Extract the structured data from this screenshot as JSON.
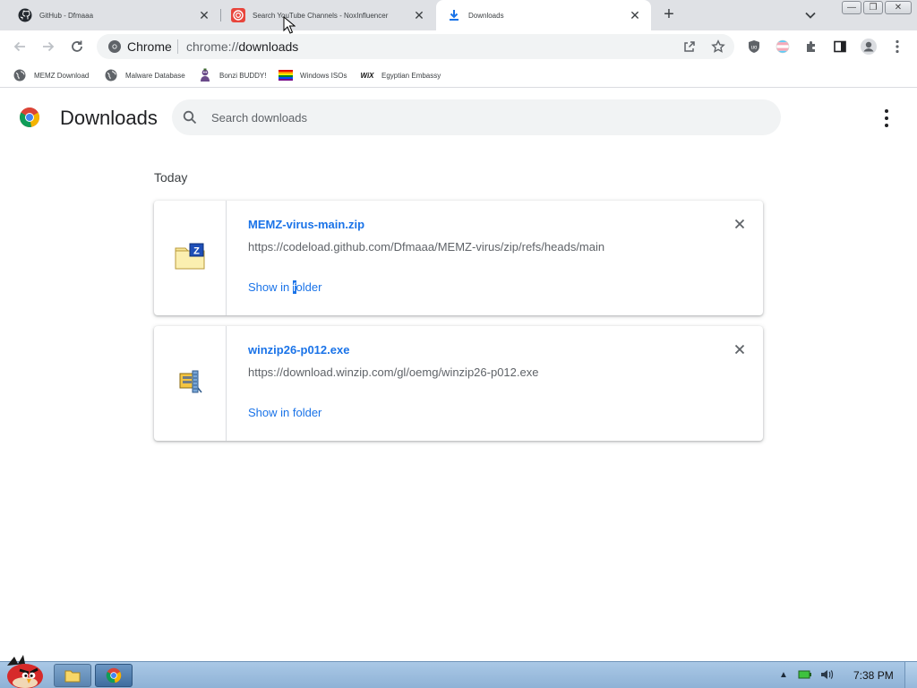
{
  "tabs": [
    {
      "title": "GitHub - Dfmaaa",
      "icon": "github-icon",
      "active": false
    },
    {
      "title": "Search YouTube Channels - NoxInfluencer",
      "icon": "noxinfluencer-icon",
      "active": false
    },
    {
      "title": "Downloads",
      "icon": "download-icon",
      "active": true
    }
  ],
  "omnibox": {
    "site_label": "Chrome",
    "url_scheme": "chrome://",
    "url_rest": "downloads"
  },
  "bookmarks": [
    {
      "label": "MEMZ Download",
      "icon": "globe-icon"
    },
    {
      "label": "Malware Database",
      "icon": "globe-icon"
    },
    {
      "label": "Bonzi BUDDY!",
      "icon": "bonzi-icon"
    },
    {
      "label": "Windows ISOs",
      "icon": "rainbow-flag-icon"
    },
    {
      "label": "Egyptian Embassy",
      "icon": "wix-icon"
    }
  ],
  "page": {
    "title": "Downloads",
    "search_placeholder": "Search downloads",
    "date_heading": "Today"
  },
  "downloads": [
    {
      "file_name": "MEMZ-virus-main.zip",
      "url": "https://codeload.github.com/Dfmaaa/MEMZ-virus/zip/refs/heads/main",
      "show_prefix": "Show in ",
      "show_caret": "f",
      "show_suffix": "older",
      "icon": "zip-folder-icon"
    },
    {
      "file_name": "winzip26-p012.exe",
      "url": "https://download.winzip.com/gl/oemg/winzip26-p012.exe",
      "show_label": "Show in folder",
      "icon": "installer-icon"
    }
  ],
  "taskbar": {
    "clock": "7:38 PM"
  },
  "colors": {
    "accent": "#1a73e8",
    "tabstrip": "#dfe1e5",
    "taskbar": "#a9c8e6"
  }
}
